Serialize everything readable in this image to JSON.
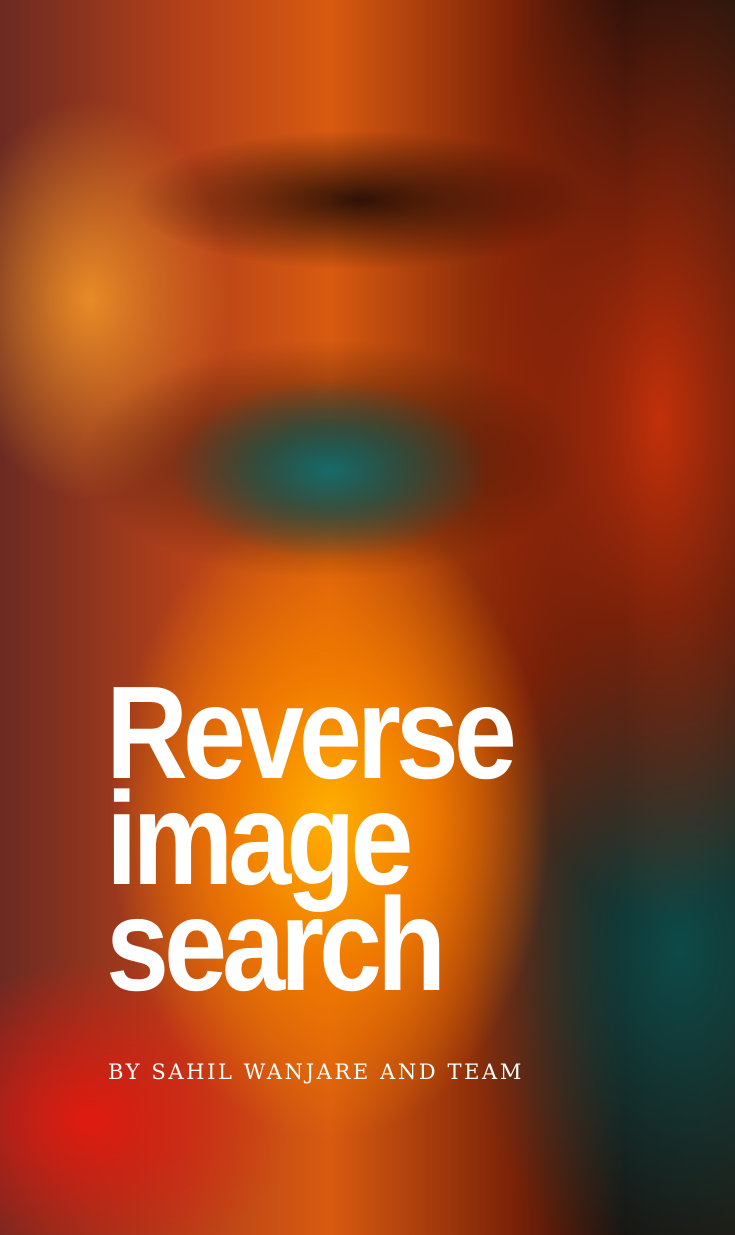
{
  "poster": {
    "title_lines": [
      "Reverse",
      "image",
      "search"
    ],
    "byline": "BY SAHIL WANJARE AND TEAM",
    "text_color": "#ffffff",
    "background_palette": [
      "#f07a00",
      "#ffb000",
      "#c2300a",
      "#0d4a48"
    ]
  }
}
